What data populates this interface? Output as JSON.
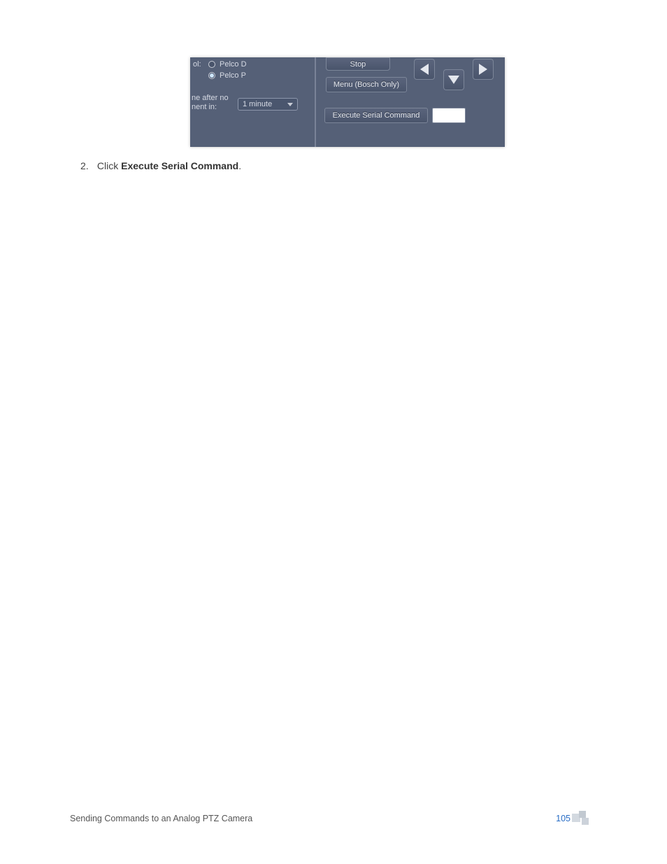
{
  "screenshot": {
    "protocol_radios": {
      "ol_label": "ol:",
      "pelco_d": "Pelco D",
      "pelco_p": "Pelco P",
      "selected": "pelco_p"
    },
    "idle_label_line1": "ne after no",
    "idle_label_line2": "nent in:",
    "idle_dropdown_value": "1 minute",
    "stop_button": "Stop",
    "menu_button": "Menu (Bosch Only)",
    "execute_button": "Execute Serial Command",
    "execute_input_value": ""
  },
  "step": {
    "number": "2.",
    "pre": "Click ",
    "bold": "Execute Serial Command",
    "post": "."
  },
  "footer": {
    "title": "Sending Commands to an Analog PTZ Camera",
    "page": "105"
  }
}
